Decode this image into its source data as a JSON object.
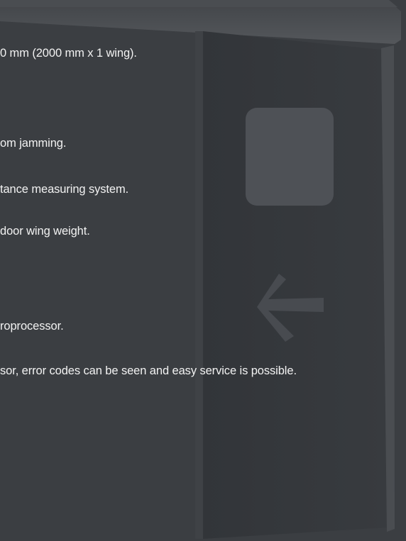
{
  "text_lines": [
    "0 mm (2000 mm x 1 wing).",
    "om jamming.",
    "tance measuring system.",
    "door wing weight.",
    "roprocessor.",
    "sor, error codes can be seen and easy service is possible."
  ],
  "colors": {
    "background": "#3b3e42",
    "text": "#f2f2f2",
    "door_panel": "#35383c",
    "door_header": "#4b4e52",
    "door_frame": "#4a4d51",
    "window": "#4e5156",
    "arrow": "#484b50"
  },
  "icons": {
    "direction_arrow": "left-arrow-icon"
  }
}
